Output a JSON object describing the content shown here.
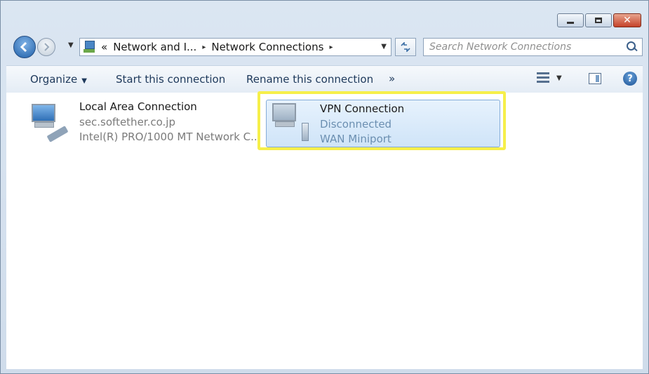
{
  "window": {
    "minimize_icon": "minimize-icon",
    "maximize_icon": "maximize-icon",
    "close_glyph": "✕"
  },
  "address": {
    "breadcrumb_prefix": "«",
    "crumbs": [
      "Network and I...",
      "Network Connections"
    ],
    "separator": "▸"
  },
  "search": {
    "placeholder": "Search Network Connections"
  },
  "toolbar": {
    "organize": "Organize",
    "start": "Start this connection",
    "rename": "Rename this connection",
    "more": "»"
  },
  "connections": [
    {
      "name": "Local Area Connection",
      "line2": "sec.softether.co.jp",
      "line3": "Intel(R) PRO/1000 MT Network C..."
    },
    {
      "name": "VPN Connection",
      "line2": "Disconnected",
      "line3": "WAN Miniport"
    }
  ],
  "colors": {
    "highlight": "#f6ef4a",
    "selection": "#cfe4f8",
    "command_text": "#1e395b"
  }
}
